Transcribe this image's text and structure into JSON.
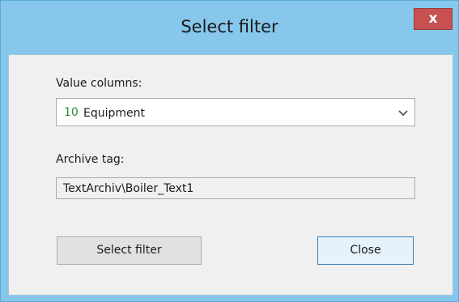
{
  "window": {
    "title": "Select filter",
    "close_glyph": "x"
  },
  "form": {
    "value_columns_label": "Value columns:",
    "value_columns_selected_number": "10",
    "value_columns_selected_text": "Equipment",
    "archive_tag_label": "Archive tag:",
    "archive_tag_value": "TextArchiv\\Boiler_Text1"
  },
  "buttons": {
    "select_filter_label": "Select filter",
    "close_label": "Close"
  },
  "colors": {
    "titlebar": "#86c7eb",
    "close_button": "#c75050",
    "client_background": "#f0f0f0",
    "number_green": "#2e8b3a"
  },
  "icons": {
    "dropdown": "chevron-down-icon"
  }
}
